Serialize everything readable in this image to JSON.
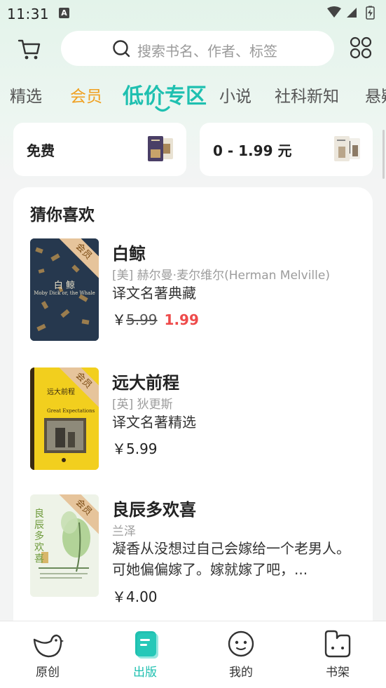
{
  "status_bar": {
    "time": "11:31",
    "notification_icon": "A"
  },
  "header": {
    "search_placeholder": "搜索书名、作者、标签"
  },
  "tabs": [
    {
      "label": "精选"
    },
    {
      "label": "会员"
    },
    {
      "label": "低价专区"
    },
    {
      "label": "小说"
    },
    {
      "label": "社科新知"
    },
    {
      "label": "悬疑"
    }
  ],
  "active_tab": "低价专区",
  "filters": [
    {
      "label": "免费"
    },
    {
      "label": "0 - 1.99 元"
    }
  ],
  "recommend": {
    "title": "猜你喜欢",
    "vip_badge": "会员",
    "books": [
      {
        "title": "白鲸",
        "author": "[美] 赫尔曼·麦尔维尔(Herman Melville)",
        "desc": "译文名著典藏",
        "price_currency": "￥",
        "price_original": "5.99",
        "price_sale": "1.99",
        "cover_title": "白 鲸",
        "cover_subtitle": "Moby Dick or, the Whale"
      },
      {
        "title": "远大前程",
        "author": "[英] 狄更斯",
        "desc": "译文名著精选",
        "price": "￥5.99",
        "cover_title": "远大前程",
        "cover_subtitle": "Great Expectations"
      },
      {
        "title": "良辰多欢喜",
        "author": "兰泽",
        "desc": "凝香从没想过自己会嫁给一个老男人。可她偏偏嫁了。嫁就嫁了吧，...",
        "price": "￥4.00",
        "cover_title": "良辰多欢喜"
      }
    ]
  },
  "bottom_nav": [
    {
      "label": "原创",
      "icon": "bird-icon"
    },
    {
      "label": "出版",
      "icon": "book-icon"
    },
    {
      "label": "我的",
      "icon": "smiley-icon"
    },
    {
      "label": "书架",
      "icon": "bookshelf-icon"
    }
  ],
  "colors": {
    "accent": "#1fc0b0",
    "vip": "#f0a020",
    "sale_price": "#ee4b4b",
    "vip_ribbon": "#e6c49b"
  }
}
